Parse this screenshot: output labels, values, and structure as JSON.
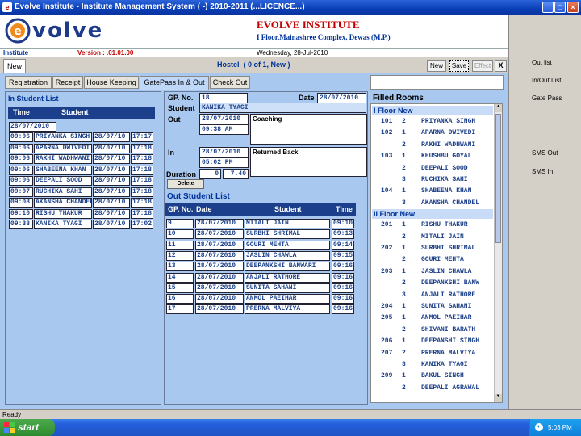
{
  "window": {
    "title": "Evolve Institute - Institute Management System ( -) 2010-2011 (...LICENCE...)"
  },
  "header": {
    "logo_text": "volve",
    "title": "EVOLVE INSTITUTE",
    "address": "I Floor,Mainashree Complex, Dewas (M.P.)"
  },
  "infobar": {
    "institute_label": "Institute",
    "version": "Version : .01.01.00",
    "date": "Wednesday, 28-Jul-2010"
  },
  "toolbar": {
    "new_tab": "New",
    "hostel_label": "Hostel",
    "record_counter": "( 0 of 1, New )",
    "new_btn": "New",
    "save_btn": "Save",
    "effect_btn": "Effect",
    "close_btn": "X"
  },
  "tabs": [
    "Registration",
    "Receipt",
    "House Keeping",
    "GatePass In & Out",
    "Check Out"
  ],
  "in_student_list": {
    "title": "In Student List",
    "col_time": "Time",
    "col_student": "Student",
    "date": "28/07/2010",
    "rows": [
      {
        "time": "09:06",
        "student": "PRIYANKA SINGH",
        "date": "28/07/10",
        "t2": "17:17"
      },
      {
        "time": "09:06",
        "student": "APARNA DWIVEDI",
        "date": "28/07/10",
        "t2": "17:18"
      },
      {
        "time": "09:06",
        "student": "RAKHI WADHWANI",
        "date": "28/07/10",
        "t2": "17:18"
      },
      {
        "time": "09:06",
        "student": "SHABEENA KHAN",
        "date": "28/07/10",
        "t2": "17:18"
      },
      {
        "time": "09:06",
        "student": "DEEPALI SOOD",
        "date": "28/07/10",
        "t2": "17:18"
      },
      {
        "time": "09:07",
        "student": "RUCHIKA SAHI",
        "date": "28/07/10",
        "t2": "17:18"
      },
      {
        "time": "09:08",
        "student": "AKANSHA CHANDEL",
        "date": "28/07/10",
        "t2": "17:18"
      },
      {
        "time": "09:10",
        "student": "RISHU THAKUR",
        "date": "28/07/10",
        "t2": "17:18"
      },
      {
        "time": "09:38",
        "student": "KANIKA TYAGI",
        "date": "28/07/10",
        "t2": "17:02"
      }
    ]
  },
  "gatepass": {
    "gp_label": "GP. No.",
    "gp_value": "18",
    "date_label": "Date",
    "date_value": "28/07/2010",
    "student_label": "Student",
    "student_value": "KANIKA TYAGI",
    "out_label": "Out",
    "out_date": "28/07/2010",
    "out_time": "09:38 AM",
    "out_reason": "Coaching",
    "in_label": "In",
    "in_date": "28/07/2010",
    "in_time": "05:02 PM",
    "in_reason": "Returned Back",
    "duration_label": "Duration",
    "duration_days": "0",
    "duration_hours": "7.40",
    "delete_btn": "Delete"
  },
  "out_student_list": {
    "title": "Out Student List",
    "col_gp": "GP. No.",
    "col_date": "Date",
    "col_student": "Student",
    "col_time": "Time",
    "rows": [
      {
        "gp": "9",
        "date": "28/07/2010",
        "student": "MITALI JAIN",
        "time": "09:10"
      },
      {
        "gp": "10",
        "date": "28/07/2010",
        "student": "SURBHI SHRIMAL",
        "time": "09:13"
      },
      {
        "gp": "11",
        "date": "28/07/2010",
        "student": "GOURI MEHTA",
        "time": "09:14"
      },
      {
        "gp": "12",
        "date": "28/07/2010",
        "student": "JASLIN CHAWLA",
        "time": "09:15"
      },
      {
        "gp": "13",
        "date": "28/07/2010",
        "student": "DEEPANKSHI BANWARI",
        "time": "09:16"
      },
      {
        "gp": "14",
        "date": "28/07/2010",
        "student": "ANJALI RATHORE",
        "time": "09:16"
      },
      {
        "gp": "15",
        "date": "28/07/2010",
        "student": "SUNITA SAHANI",
        "time": "09:16"
      },
      {
        "gp": "16",
        "date": "28/07/2010",
        "student": "ANMOL PAEIHAR",
        "time": "09:16"
      },
      {
        "gp": "17",
        "date": "28/07/2010",
        "student": "PRERNA MALVIYA",
        "time": "09:16"
      }
    ]
  },
  "filled_rooms": {
    "title": "Filled Rooms",
    "floors": [
      {
        "name": "I Floor New",
        "rows": [
          {
            "room": "101",
            "bed": "2",
            "student": "PRIYANKA SINGH"
          },
          {
            "room": "102",
            "bed": "1",
            "student": "APARNA DWIVEDI"
          },
          {
            "room": "",
            "bed": "2",
            "student": "RAKHI WADHWANI"
          },
          {
            "room": "103",
            "bed": "1",
            "student": "KHUSHBU GOYAL"
          },
          {
            "room": "",
            "bed": "2",
            "student": "DEEPALI SOOD"
          },
          {
            "room": "",
            "bed": "3",
            "student": "RUCHIKA SAHI"
          },
          {
            "room": "104",
            "bed": "1",
            "student": "SHABEENA KHAN"
          },
          {
            "room": "",
            "bed": "3",
            "student": "AKANSHA CHANDEL"
          }
        ]
      },
      {
        "name": "II Floor New",
        "rows": [
          {
            "room": "201",
            "bed": "1",
            "student": "RISHU THAKUR"
          },
          {
            "room": "",
            "bed": "2",
            "student": "MITALI JAIN"
          },
          {
            "room": "202",
            "bed": "1",
            "student": "SURBHI SHRIMAL"
          },
          {
            "room": "",
            "bed": "2",
            "student": "GOURI MEHTA"
          },
          {
            "room": "203",
            "bed": "1",
            "student": "JASLIN CHAWLA"
          },
          {
            "room": "",
            "bed": "2",
            "student": "DEEPANKSHI BANW"
          },
          {
            "room": "",
            "bed": "3",
            "student": "ANJALI RATHORE"
          },
          {
            "room": "204",
            "bed": "1",
            "student": "SUNITA SAHANI"
          },
          {
            "room": "205",
            "bed": "1",
            "student": "ANMOL PAEIHAR"
          },
          {
            "room": "",
            "bed": "2",
            "student": "SHIVANI BARATH"
          },
          {
            "room": "206",
            "bed": "1",
            "student": "DEEPANSHI SINGH"
          },
          {
            "room": "207",
            "bed": "2",
            "student": "PRERNA MALVIYA"
          },
          {
            "room": "",
            "bed": "3",
            "student": "KANIKA TYAGI"
          },
          {
            "room": "209",
            "bed": "1",
            "student": "BAKUL SINGH"
          },
          {
            "room": "",
            "bed": "2",
            "student": "DEEPALI AGRAWAL"
          }
        ]
      }
    ]
  },
  "sidebar": [
    "Out list",
    "In/Out List",
    "Gate Pass",
    "SMS Out",
    "SMS In"
  ],
  "status": {
    "text": "Ready"
  },
  "taskbar": {
    "start": "start",
    "clock": "5:03 PM"
  }
}
